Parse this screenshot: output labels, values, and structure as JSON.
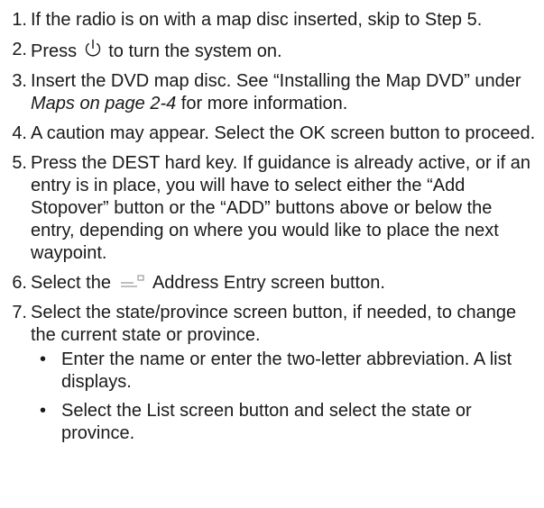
{
  "steps": [
    {
      "num": "1.",
      "text": "If the radio is on with a map disc inserted, skip to Step 5."
    },
    {
      "num": "2.",
      "text_before": "Press",
      "icon": "power-icon",
      "text_after": "to turn the system on."
    },
    {
      "num": "3.",
      "text_before": "Insert the DVD map disc. See “Installing the Map DVD” under",
      "italic": "Maps on page 2-4",
      "text_after": "for more information."
    },
    {
      "num": "4.",
      "text": "A caution may appear. Select the OK screen button to proceed."
    },
    {
      "num": "5.",
      "text": "Press the DEST hard key. If guidance is already active, or if an entry is in place, you will have to select either the “Add Stopover” button or the “ADD” buttons above or below the entry, depending on where you would like to place the next waypoint."
    },
    {
      "num": "6.",
      "text_before": "Select the",
      "icon": "address-entry-icon",
      "text_after": "Address Entry screen button."
    },
    {
      "num": "7.",
      "text": "Select the state/province screen button, if needed, to change the current state or province.",
      "bullets": [
        "Enter the name or enter the two-letter abbreviation. A list displays.",
        "Select the List screen button and select the state or province."
      ]
    }
  ],
  "bullet_symbol": "•"
}
